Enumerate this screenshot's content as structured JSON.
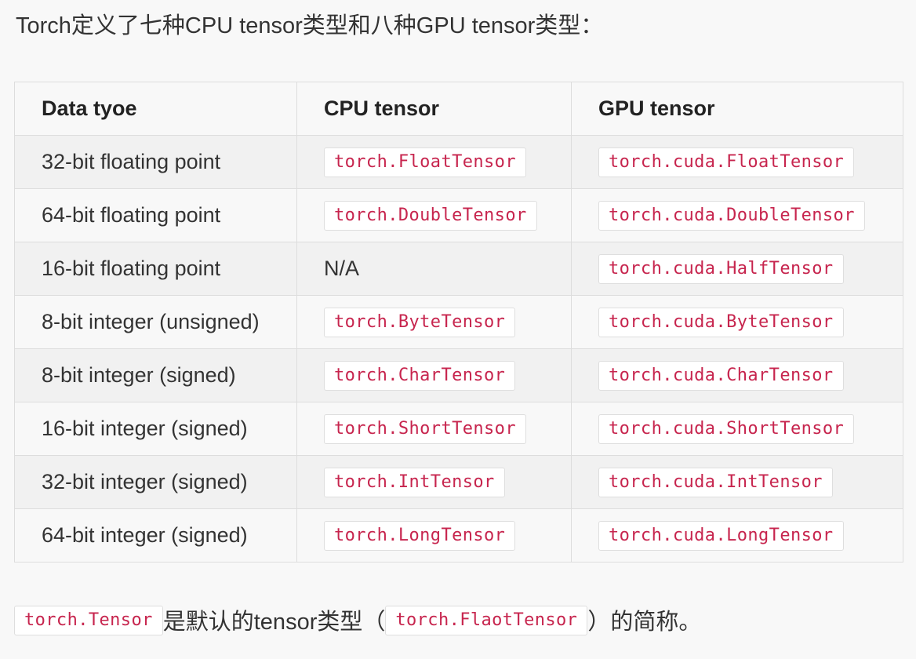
{
  "intro": "Torch定义了七种CPU tensor类型和八种GPU tensor类型：",
  "table": {
    "headers": [
      "Data tyoe",
      "CPU tensor",
      "GPU tensor"
    ],
    "rows": [
      {
        "type": "32-bit floating point",
        "cpu": "torch.FloatTensor",
        "gpu": "torch.cuda.FloatTensor"
      },
      {
        "type": "64-bit floating point",
        "cpu": "torch.DoubleTensor",
        "gpu": "torch.cuda.DoubleTensor"
      },
      {
        "type": "16-bit floating point",
        "cpu": "N/A",
        "gpu": "torch.cuda.HalfTensor"
      },
      {
        "type": "8-bit integer (unsigned)",
        "cpu": "torch.ByteTensor",
        "gpu": "torch.cuda.ByteTensor"
      },
      {
        "type": "8-bit integer (signed)",
        "cpu": "torch.CharTensor",
        "gpu": "torch.cuda.CharTensor"
      },
      {
        "type": "16-bit integer (signed)",
        "cpu": "torch.ShortTensor",
        "gpu": "torch.cuda.ShortTensor"
      },
      {
        "type": "32-bit integer (signed)",
        "cpu": "torch.IntTensor",
        "gpu": "torch.cuda.IntTensor"
      },
      {
        "type": "64-bit integer (signed)",
        "cpu": "torch.LongTensor",
        "gpu": "torch.cuda.LongTensor"
      }
    ]
  },
  "outro": {
    "code1": "torch.Tensor",
    "text1": "是默认的tensor类型（",
    "code2": "torch.FlaotTensor",
    "text2": "）的简称。"
  },
  "colors": {
    "code_text": "#c7254e",
    "background": "#f8f8f8",
    "row_stripe": "#f1f1f1",
    "border": "#dddddd"
  }
}
